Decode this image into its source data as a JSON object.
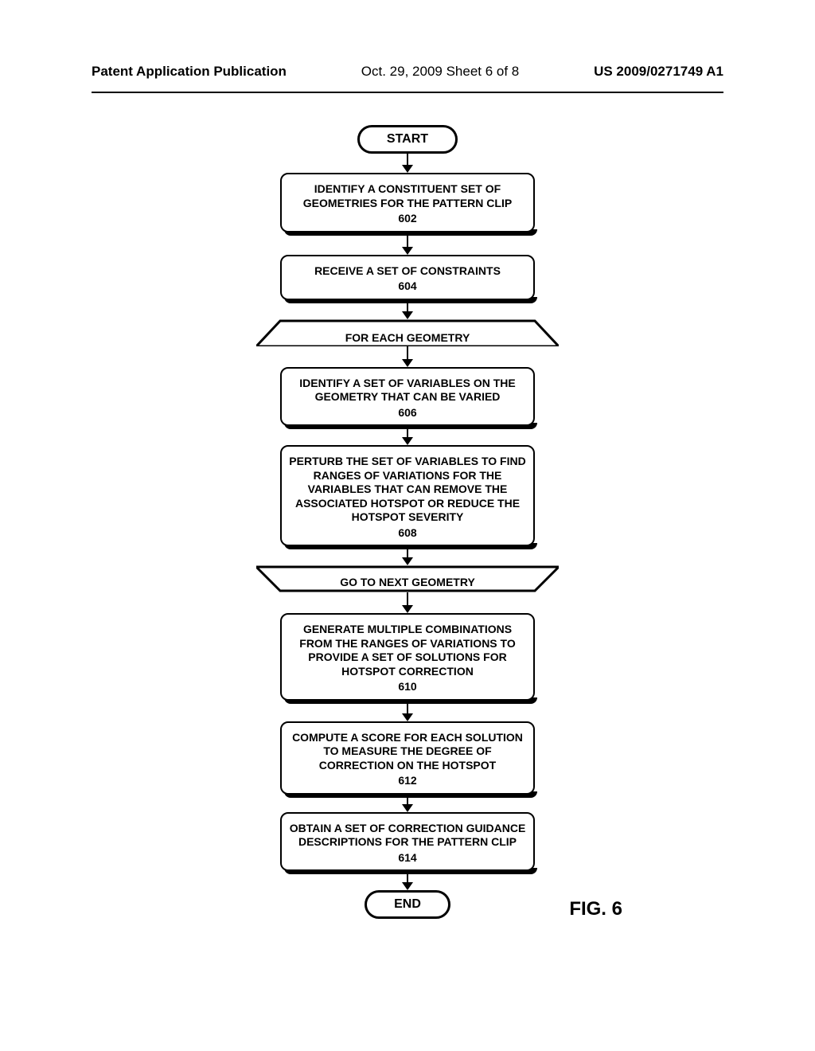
{
  "header": {
    "left": "Patent Application Publication",
    "center": "Oct. 29, 2009  Sheet 6 of 8",
    "right": "US 2009/0271749 A1"
  },
  "figure_label": "FIG. 6",
  "terminals": {
    "start": "START",
    "end": "END"
  },
  "steps": {
    "s602": {
      "text": "IDENTIFY A CONSTITUENT SET OF GEOMETRIES FOR THE PATTERN CLIP",
      "num": "602"
    },
    "s604": {
      "text": "RECEIVE A SET OF CONSTRAINTS",
      "num": "604"
    },
    "loop_start": "FOR EACH GEOMETRY",
    "s606": {
      "text": "IDENTIFY A SET OF VARIABLES ON THE GEOMETRY THAT CAN BE VARIED",
      "num": "606"
    },
    "s608": {
      "text": "PERTURB THE SET OF VARIABLES  TO FIND RANGES OF VARIATIONS FOR THE VARIABLES THAT CAN REMOVE THE ASSOCIATED HOTSPOT OR REDUCE THE HOTSPOT SEVERITY",
      "num": "608"
    },
    "loop_end": "GO TO NEXT GEOMETRY",
    "s610": {
      "text": "GENERATE MULTIPLE COMBINATIONS FROM THE RANGES OF VARIATIONS TO PROVIDE A SET OF SOLUTIONS FOR HOTSPOT CORRECTION",
      "num": "610"
    },
    "s612": {
      "text": "COMPUTE A SCORE FOR EACH SOLUTION TO MEASURE THE DEGREE OF CORRECTION ON THE HOTSPOT",
      "num": "612"
    },
    "s614": {
      "text": "OBTAIN A SET OF CORRECTION GUIDANCE DESCRIPTIONS FOR THE PATTERN CLIP",
      "num": "614"
    }
  }
}
